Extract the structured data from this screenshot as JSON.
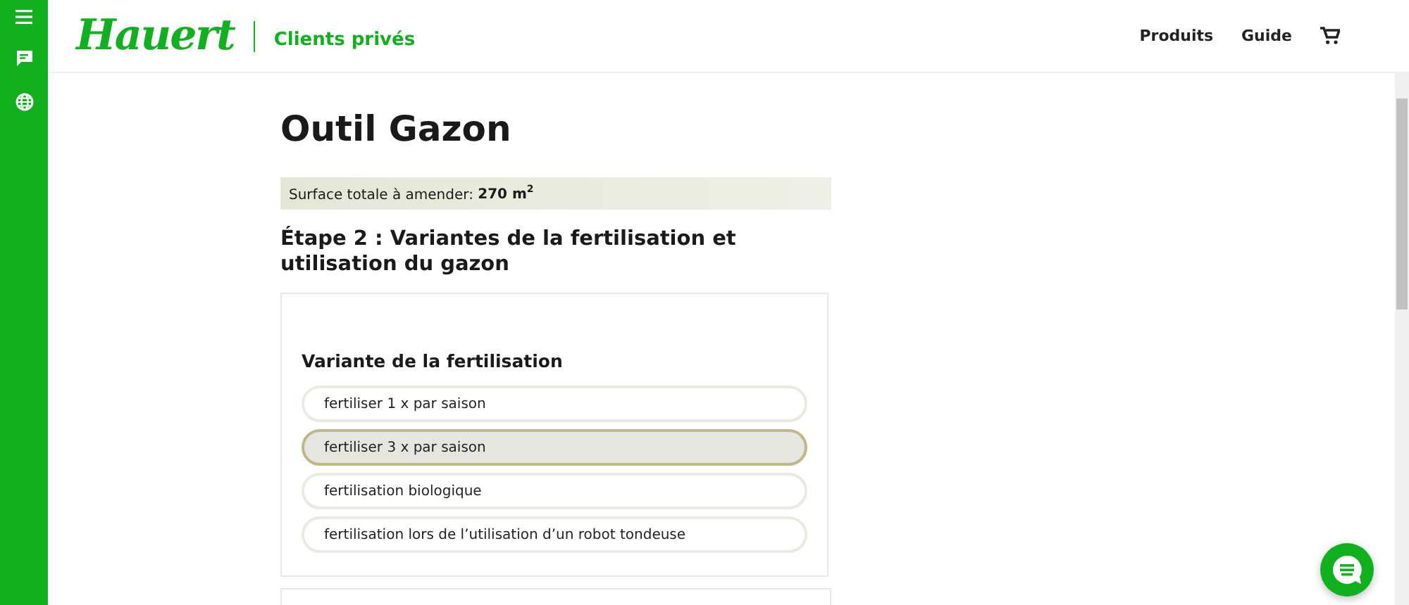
{
  "header": {
    "logo": "Hauert",
    "subtitle": "Clients privés",
    "nav": [
      "Produits",
      "Guide"
    ]
  },
  "page_title": "Outil Gazon",
  "summary": "Surface totale à amender: **270 m$^{2}$**",
  "step_title": "Étape 2 : Variantes de la fertilisation et utilisation du gazon",
  "section": {
    "title": "Variante de la fertilisation",
    "options": [
      {
        "label": "fertiliser 1 x par saison",
        "selected": false
      },
      {
        "label": "fertiliser 3 x par saison",
        "selected": true
      },
      {
        "label": "fertilisation biologique",
        "selected": false
      },
      {
        "label": "fertilisation lors de l’utilisation d’un robot tondeuse",
        "selected": false
      }
    ]
  }
}
